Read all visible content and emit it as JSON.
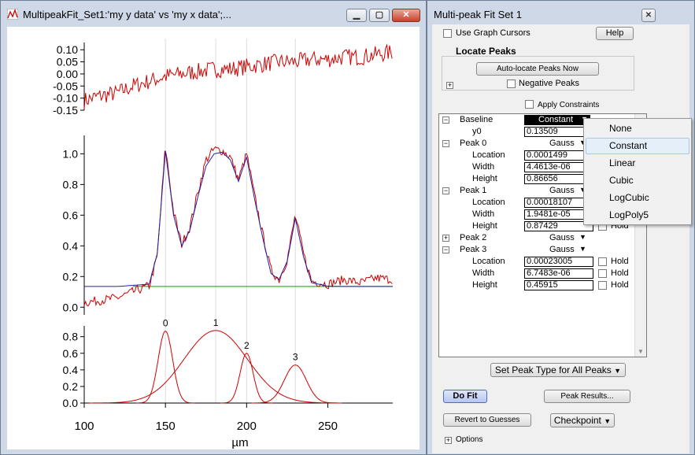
{
  "graph_window": {
    "title": "MultipeakFit_Set1:'my y data' vs 'my x data';...",
    "x_axis_label": "µm"
  },
  "panel_window": {
    "title": "Multi-peak Fit Set 1",
    "use_cursors_label": "Use Graph Cursors",
    "help_label": "Help",
    "locate_peaks_label": "Locate Peaks",
    "auto_locate_label": "Auto-locate Peaks Now",
    "negative_peaks_label": "Negative Peaks",
    "apply_constraints_label": "Apply Constraints",
    "set_peak_type_label": "Set Peak Type for All Peaks",
    "do_fit_label": "Do Fit",
    "peak_results_label": "Peak Results...",
    "revert_label": "Revert to Guesses",
    "checkpoint_label": "Checkpoint",
    "options_label": "Options",
    "hold_label": "Hold",
    "tree": {
      "baseline": {
        "label": "Baseline",
        "type": "Constant",
        "param": "y0",
        "value": "0.13509"
      },
      "peaks": [
        {
          "label": "Peak 0",
          "type": "Gauss",
          "expanded": true,
          "location": "0.0001499",
          "width": "4.4613e-06",
          "height": "0.86656"
        },
        {
          "label": "Peak 1",
          "type": "Gauss",
          "expanded": true,
          "location": "0.00018107",
          "width": "1.9481e-05",
          "height": "0.87429"
        },
        {
          "label": "Peak 2",
          "type": "Gauss",
          "expanded": false
        },
        {
          "label": "Peak 3",
          "type": "Gauss",
          "expanded": true,
          "location": "0.00023005",
          "width": "6.7483e-06",
          "height": "0.45915"
        }
      ],
      "param_labels": {
        "location": "Location",
        "width": "Width",
        "height": "Height"
      }
    }
  },
  "baseline_menu": {
    "items": [
      "None",
      "Constant",
      "Linear",
      "Cubic",
      "LogCubic",
      "LogPoly5"
    ],
    "highlighted": "Constant"
  },
  "chart_data": [
    {
      "type": "line",
      "title": "",
      "xlabel": "",
      "ylabel": "",
      "xlim": [
        100,
        290
      ],
      "ylim": [
        -0.15,
        0.13
      ],
      "y_ticks": [
        "0.10",
        "0.05",
        "0.00",
        "-0.05",
        "-0.10",
        "-0.15"
      ],
      "series": [
        {
          "color": "#d00000",
          "x": [
            100,
            110,
            120,
            130,
            140,
            150,
            160,
            170,
            180,
            190,
            200,
            210,
            220,
            230,
            240,
            250,
            260,
            270,
            280,
            290
          ],
          "y": [
            -0.11,
            -0.09,
            -0.08,
            -0.05,
            -0.03,
            -0.01,
            0.0,
            0.01,
            0.02,
            0.02,
            0.03,
            0.04,
            0.05,
            0.05,
            0.06,
            0.06,
            0.07,
            0.07,
            0.08,
            0.09
          ]
        }
      ]
    },
    {
      "type": "line",
      "title": "",
      "xlabel": "",
      "ylabel": "",
      "xlim": [
        100,
        290
      ],
      "ylim": [
        -0.05,
        1.12
      ],
      "y_ticks": [
        "1.0",
        "0.8",
        "0.6",
        "0.4",
        "0.2",
        "0.0"
      ],
      "series": [
        {
          "color": "#d00000",
          "x": [
            100,
            120,
            140,
            145,
            150,
            155,
            160,
            165,
            170,
            175,
            180,
            185,
            190,
            195,
            200,
            205,
            210,
            215,
            220,
            225,
            230,
            235,
            240,
            250,
            260,
            270,
            280,
            290
          ],
          "y": [
            0.03,
            0.06,
            0.14,
            0.33,
            1.05,
            0.62,
            0.41,
            0.52,
            0.75,
            0.96,
            1.03,
            1.02,
            0.98,
            0.83,
            1.0,
            0.72,
            0.47,
            0.24,
            0.18,
            0.31,
            0.6,
            0.35,
            0.17,
            0.15,
            0.18,
            0.16,
            0.19,
            0.18
          ]
        },
        {
          "color": "#2020a0",
          "x": [
            100,
            120,
            140,
            145,
            150,
            155,
            160,
            165,
            170,
            175,
            180,
            185,
            190,
            195,
            200,
            205,
            210,
            215,
            220,
            225,
            230,
            235,
            240,
            250,
            260,
            270,
            280,
            290
          ],
          "y": [
            0.135,
            0.135,
            0.15,
            0.35,
            1.02,
            0.6,
            0.4,
            0.5,
            0.72,
            0.92,
            1.0,
            1.01,
            0.96,
            0.82,
            0.98,
            0.7,
            0.45,
            0.22,
            0.18,
            0.3,
            0.58,
            0.33,
            0.16,
            0.137,
            0.135,
            0.135,
            0.135,
            0.135
          ]
        },
        {
          "color": "#00a000",
          "x": [
            130,
            290
          ],
          "y": [
            0.135,
            0.135
          ]
        }
      ]
    },
    {
      "type": "line",
      "title": "",
      "xlabel": "µm",
      "ylabel": "",
      "xlim": [
        100,
        290
      ],
      "ylim": [
        0.0,
        0.93
      ],
      "x_ticks": [
        "100",
        "150",
        "200",
        "250"
      ],
      "y_ticks": [
        "0.8",
        "0.6",
        "0.4",
        "0.2",
        "0.0"
      ],
      "annotations": [
        "0",
        "1",
        "2",
        "3"
      ],
      "series": [
        {
          "name": "0",
          "color": "#d00000",
          "center": 150,
          "sigma": 4.46,
          "height": 0.867
        },
        {
          "name": "1",
          "color": "#d00000",
          "center": 181,
          "sigma": 19.48,
          "height": 0.874
        },
        {
          "name": "2",
          "color": "#d00000",
          "center": 200,
          "sigma": 4.0,
          "height": 0.6
        },
        {
          "name": "3",
          "color": "#d00000",
          "center": 230,
          "sigma": 6.75,
          "height": 0.459
        }
      ]
    }
  ]
}
